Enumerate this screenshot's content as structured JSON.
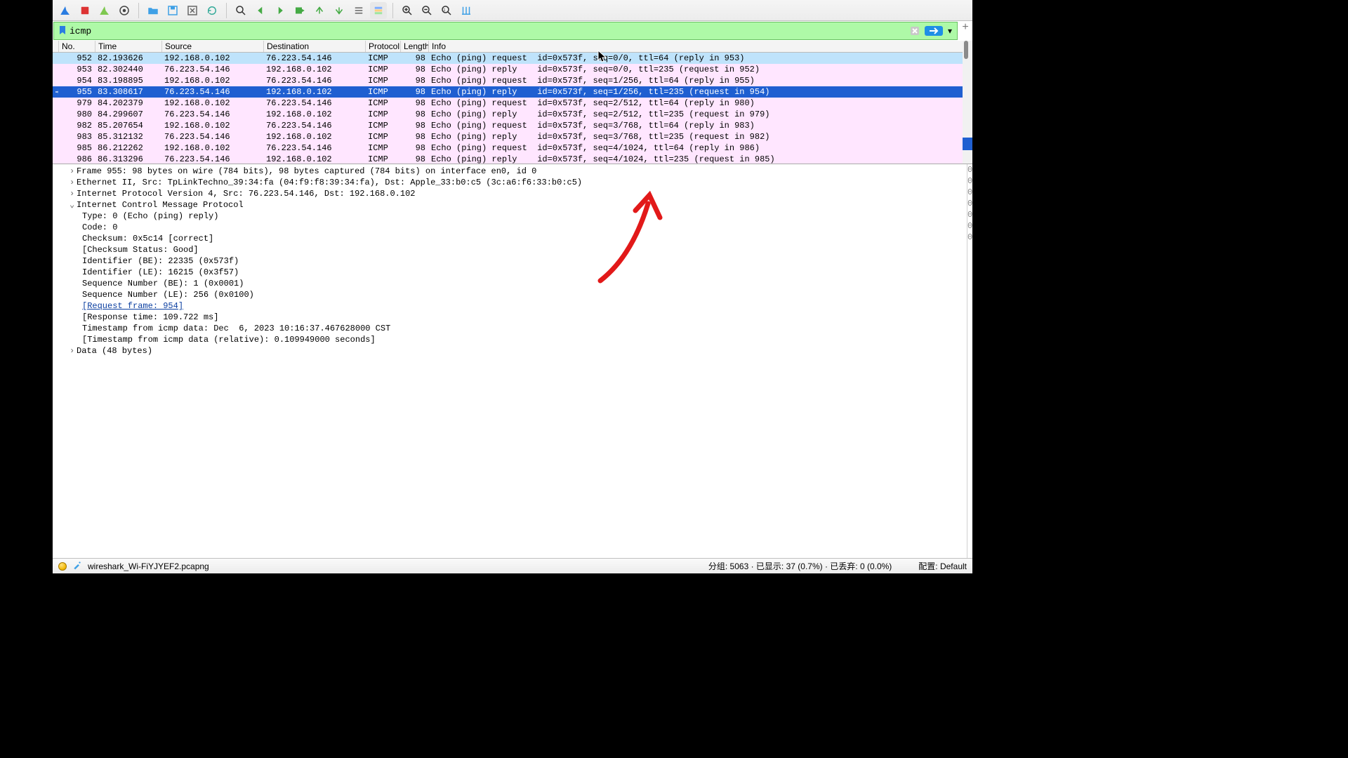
{
  "filter": {
    "value": "icmp"
  },
  "columns": [
    "No.",
    "Time",
    "Source",
    "Destination",
    "Protocol",
    "Length",
    "Info"
  ],
  "selected_row_index": 3,
  "related_row_index": 0,
  "packets": [
    {
      "no": "952",
      "time": "82.193626",
      "src": "192.168.0.102",
      "dst": "76.223.54.146",
      "proto": "ICMP",
      "len": "98",
      "info": "Echo (ping) request  id=0x573f, seq=0/0, ttl=64 (reply in 953)"
    },
    {
      "no": "953",
      "time": "82.302440",
      "src": "76.223.54.146",
      "dst": "192.168.0.102",
      "proto": "ICMP",
      "len": "98",
      "info": "Echo (ping) reply    id=0x573f, seq=0/0, ttl=235 (request in 952)"
    },
    {
      "no": "954",
      "time": "83.198895",
      "src": "192.168.0.102",
      "dst": "76.223.54.146",
      "proto": "ICMP",
      "len": "98",
      "info": "Echo (ping) request  id=0x573f, seq=1/256, ttl=64 (reply in 955)"
    },
    {
      "no": "955",
      "time": "83.308617",
      "src": "76.223.54.146",
      "dst": "192.168.0.102",
      "proto": "ICMP",
      "len": "98",
      "info": "Echo (ping) reply    id=0x573f, seq=1/256, ttl=235 (request in 954)"
    },
    {
      "no": "979",
      "time": "84.202379",
      "src": "192.168.0.102",
      "dst": "76.223.54.146",
      "proto": "ICMP",
      "len": "98",
      "info": "Echo (ping) request  id=0x573f, seq=2/512, ttl=64 (reply in 980)"
    },
    {
      "no": "980",
      "time": "84.299607",
      "src": "76.223.54.146",
      "dst": "192.168.0.102",
      "proto": "ICMP",
      "len": "98",
      "info": "Echo (ping) reply    id=0x573f, seq=2/512, ttl=235 (request in 979)"
    },
    {
      "no": "982",
      "time": "85.207654",
      "src": "192.168.0.102",
      "dst": "76.223.54.146",
      "proto": "ICMP",
      "len": "98",
      "info": "Echo (ping) request  id=0x573f, seq=3/768, ttl=64 (reply in 983)"
    },
    {
      "no": "983",
      "time": "85.312132",
      "src": "76.223.54.146",
      "dst": "192.168.0.102",
      "proto": "ICMP",
      "len": "98",
      "info": "Echo (ping) reply    id=0x573f, seq=3/768, ttl=235 (request in 982)"
    },
    {
      "no": "985",
      "time": "86.212262",
      "src": "192.168.0.102",
      "dst": "76.223.54.146",
      "proto": "ICMP",
      "len": "98",
      "info": "Echo (ping) request  id=0x573f, seq=4/1024, ttl=64 (reply in 986)"
    },
    {
      "no": "986",
      "time": "86.313296",
      "src": "76.223.54.146",
      "dst": "192.168.0.102",
      "proto": "ICMP",
      "len": "98",
      "info": "Echo (ping) reply    id=0x573f, seq=4/1024, ttl=235 (request in 985)"
    }
  ],
  "details": {
    "frame": "Frame 955: 98 bytes on wire (784 bits), 98 bytes captured (784 bits) on interface en0, id 0",
    "eth": "Ethernet II, Src: TpLinkTechno_39:34:fa (04:f9:f8:39:34:fa), Dst: Apple_33:b0:c5 (3c:a6:f6:33:b0:c5)",
    "ip": "Internet Protocol Version 4, Src: 76.223.54.146, Dst: 192.168.0.102",
    "icmp_header": "Internet Control Message Protocol",
    "lines": [
      "Type: 0 (Echo (ping) reply)",
      "Code: 0",
      "Checksum: 0x5c14 [correct]",
      "[Checksum Status: Good]",
      "Identifier (BE): 22335 (0x573f)",
      "Identifier (LE): 16215 (0x3f57)",
      "Sequence Number (BE): 1 (0x0001)",
      "Sequence Number (LE): 256 (0x0100)"
    ],
    "request_frame": "[Request frame: 954]",
    "after_link": [
      "[Response time: 109.722 ms]",
      "Timestamp from icmp data: Dec  6, 2023 10:16:37.467628000 CST",
      "[Timestamp from icmp data (relative): 0.109949000 seconds]"
    ],
    "data": "Data (48 bytes)"
  },
  "statusbar": {
    "file": "wireshark_Wi-FiYJYEF2.pcapng",
    "counts": "分组: 5063 · 已显示: 37 (0.7%) · 已丢弃: 0 (0.0%)",
    "profile": "配置: Default"
  }
}
